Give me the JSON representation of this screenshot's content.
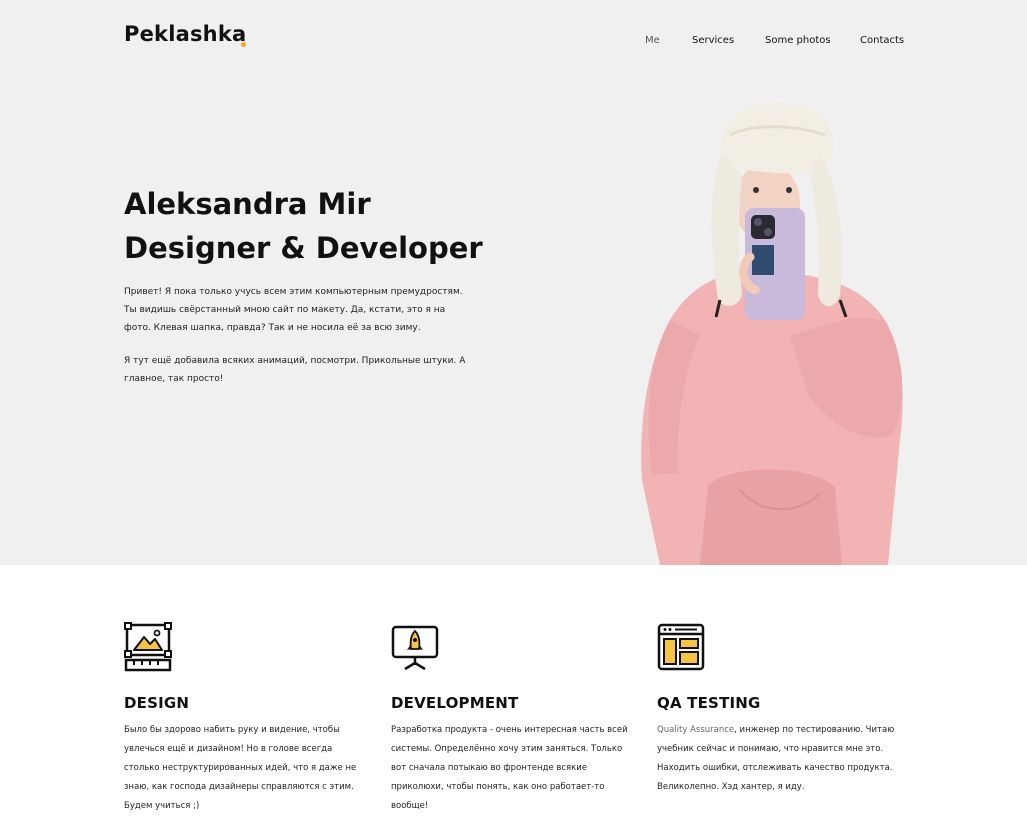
{
  "brand": {
    "name": "Peklashka",
    "accent": "#f5a623"
  },
  "nav": {
    "items": [
      {
        "label": "Me",
        "active": true
      },
      {
        "label": "Services"
      },
      {
        "label": "Some photos"
      },
      {
        "label": "Contacts"
      }
    ]
  },
  "hero": {
    "title_line1": "Aleksandra Mir",
    "title_line2": "Designer & Developer",
    "para1": "Привет! Я пока только учусь всем этим компьютерным премудростям. Ты видишь свёрстанный мною сайт по макету. Да, кстати, это я на фото. Клевая шапка, правда? Так и не носила её за всю зиму.",
    "para2": "Я тут ещё добавила всяких анимаций, посмотри. Прикольные штуки. А главное, так просто!"
  },
  "services": [
    {
      "icon": "design-icon",
      "title": "DESIGN",
      "text": "Было бы здорово набить руку и видение, чтобы увлечься ещё и дизайном! Но в голове всегда столько неструктурированных идей, что я даже не знаю, как господа дизайнеры справляются с этим.",
      "text2": "Будем учиться ;)"
    },
    {
      "icon": "development-icon",
      "title": "DEVELOPMENT",
      "text": "Разработка продукта - очень интересная часть всей системы. Определённо хочу этим заняться. Только вот сначала потыкаю во фронтенде всякие приколюхи, чтобы понять, как оно работает-то вообще!"
    },
    {
      "icon": "qa-testing-icon",
      "title": "QA TESTING",
      "text_highlight": "Quality Assurance",
      "text": ", инженер по тестированию. Читаю учебник сейчас и понимаю, что нравится мне это. Находить ошибки, отслеживать качество продукта. Великолепно. Хэд хантер, я иду."
    }
  ]
}
